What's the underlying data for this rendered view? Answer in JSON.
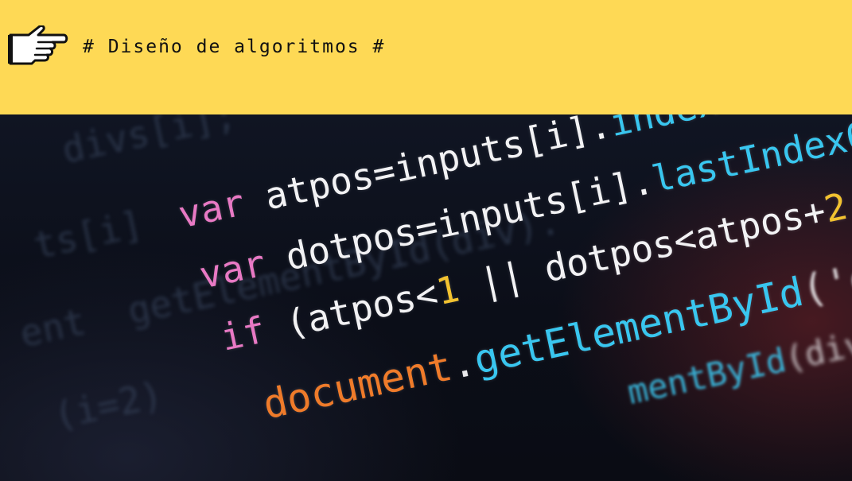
{
  "header": {
    "title": "# Diseño de algoritmos #",
    "icon": "pointing-hand-icon",
    "background": "#fed955"
  },
  "code": {
    "ghost_lines": [
      "divs[i];",
      "ts[i]",
      "ent  getElementById(div).",
      "(i=2)"
    ],
    "lines": [
      {
        "kw": "var",
        "rest": " atpos=inputs[i].",
        "fn": "indexOf",
        "tail": "(\"@\");"
      },
      {
        "kw": "var",
        "rest": " dotpos=inputs[i].",
        "fn": "lastIndexOf",
        "tail": "(\".\");"
      },
      {
        "kw": "if",
        "a": " (atpos<",
        "num1": "1",
        "b": " || dotpos<atpos+",
        "num2": "2",
        "c": " ||"
      },
      {
        "obj": "document",
        "dot": ".",
        "fn": "getElementById",
        "tail": "('errEmail').innerHTML"
      },
      {
        "fn": "mentById",
        "tail": "(div).inner"
      }
    ]
  },
  "colors": {
    "keyword": "#e879c4",
    "function": "#39c6ef",
    "object": "#ef7b2a",
    "number": "#f2c230"
  }
}
